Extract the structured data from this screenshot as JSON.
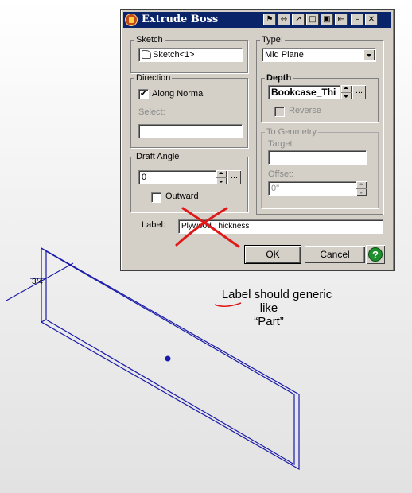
{
  "dialog": {
    "title": "Extrude Boss",
    "titlebar_buttons": [
      "⚑",
      "↔",
      "↗",
      "□",
      "▣",
      "⇤",
      "–",
      "✕"
    ],
    "sketch": {
      "legend": "Sketch",
      "value": "Sketch<1>"
    },
    "type": {
      "legend": "Type:",
      "value": "Mid Plane"
    },
    "direction": {
      "legend": "Direction",
      "along_normal_label": "Along Normal",
      "along_normal_checked": "✔",
      "select_label": "Select:",
      "select_value": ""
    },
    "depth": {
      "legend": "Depth",
      "value": "Bookcase_Thi",
      "browse": "...",
      "reverse_label": "Reverse"
    },
    "to_geometry": {
      "legend": "To Geometry",
      "target_label": "Target:",
      "target_value": "",
      "offset_label": "Offset:",
      "offset_value": "0\""
    },
    "draft_angle": {
      "legend": "Draft Angle",
      "value": "0",
      "browse": "...",
      "outward_label": "Outward"
    },
    "label": {
      "label": "Label:",
      "value": "Plywood Thickness"
    },
    "buttons": {
      "ok": "OK",
      "cancel": "Cancel",
      "help": "?"
    }
  },
  "drawing": {
    "dimension_text": "3/4"
  },
  "annotation": {
    "line1": "Label should generic",
    "line2": "like",
    "line3": "“Part”"
  },
  "colors": {
    "titlebar": "#0a246a",
    "dialog_face": "#d4d0c8",
    "sketch_line": "#1a1aa8",
    "red_markup": "#e01818"
  }
}
